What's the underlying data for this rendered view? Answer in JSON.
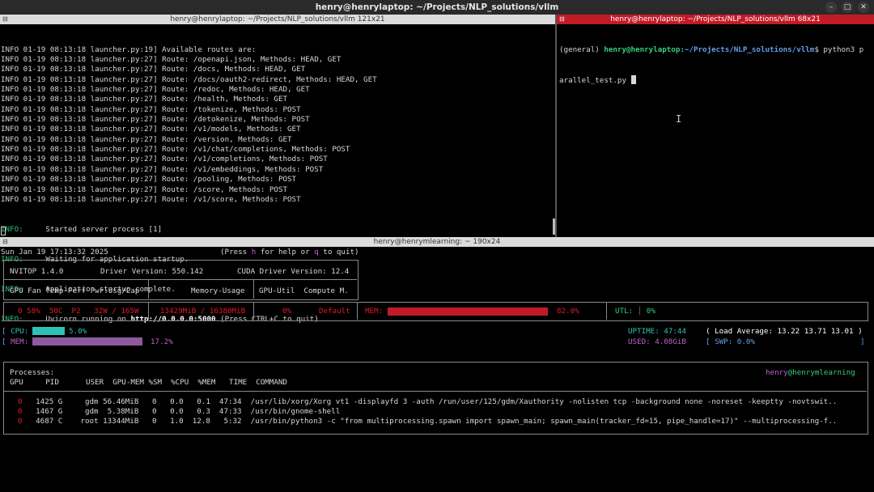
{
  "window": {
    "title": "henry@henrylaptop: ~/Projects/NLP_solutions/vllm",
    "minimize": "–",
    "maximize": "□",
    "close": "✕"
  },
  "pane_left": {
    "title": "henry@henrylaptop: ~/Projects/NLP_solutions/vllm 121x21",
    "lines": [
      "INFO 01-19 08:13:18 launcher.py:19] Available routes are:",
      "INFO 01-19 08:13:18 launcher.py:27] Route: /openapi.json, Methods: HEAD, GET",
      "INFO 01-19 08:13:18 launcher.py:27] Route: /docs, Methods: HEAD, GET",
      "INFO 01-19 08:13:18 launcher.py:27] Route: /docs/oauth2-redirect, Methods: HEAD, GET",
      "INFO 01-19 08:13:18 launcher.py:27] Route: /redoc, Methods: HEAD, GET",
      "INFO 01-19 08:13:18 launcher.py:27] Route: /health, Methods: GET",
      "INFO 01-19 08:13:18 launcher.py:27] Route: /tokenize, Methods: POST",
      "INFO 01-19 08:13:18 launcher.py:27] Route: /detokenize, Methods: POST",
      "INFO 01-19 08:13:18 launcher.py:27] Route: /v1/models, Methods: GET",
      "INFO 01-19 08:13:18 launcher.py:27] Route: /version, Methods: GET",
      "INFO 01-19 08:13:18 launcher.py:27] Route: /v1/chat/completions, Methods: POST",
      "INFO 01-19 08:13:18 launcher.py:27] Route: /v1/completions, Methods: POST",
      "INFO 01-19 08:13:18 launcher.py:27] Route: /v1/embeddings, Methods: POST",
      "INFO 01-19 08:13:18 launcher.py:27] Route: /pooling, Methods: POST",
      "INFO 01-19 08:13:18 launcher.py:27] Route: /score, Methods: POST",
      "INFO 01-19 08:13:18 launcher.py:27] Route: /v1/score, Methods: POST"
    ],
    "uvicorn": [
      {
        "level": "INFO:",
        "msg": "     Started server process [1]"
      },
      {
        "level": "INFO:",
        "msg": "     Waiting for application startup."
      },
      {
        "level": "INFO:",
        "msg": "     Application startup complete."
      }
    ],
    "running": {
      "level": "INFO:",
      "pre": "     Uvicorn running on ",
      "url": "http://0.0.0.0:5000",
      "post": " (Press CTRL+C to quit)"
    }
  },
  "pane_right": {
    "title": "henry@henrylaptop: ~/Projects/NLP_solutions/vllm 68x21",
    "env": "(general) ",
    "user_host": "henry@henrylaptop",
    "path": ":~/Projects/NLP_solutions/vllm",
    "cmd1": "$ python3 p",
    "cmd2": "arallel_test.py "
  },
  "pane_bottom": {
    "title": "henry@henrymlearning: ~ 190x24",
    "date": "Sun Jan 19 17:13:32 2025",
    "help": {
      "pre": "(Press ",
      "h": "h",
      "mid": " for help or ",
      "q": "q",
      "post": " to quit)"
    },
    "header": {
      "nvitop": "NVITOP 1.4.0",
      "driver": "Driver Version: 550.142",
      "cuda": "CUDA Driver Version: 12.4",
      "col1": "GPU Fan Temp Perf Pwr:Usg/Cap",
      "col2": "Memory-Usage",
      "col3": "GPU-Util  Compute M."
    },
    "gpu": {
      "id": "0",
      "fan": "58%",
      "temp": "50C",
      "perf": "P2",
      "pwr": "32W / 165W",
      "mem": "13429MiB / 16380MiB",
      "util": "0%",
      "compute": "Default",
      "mem_label": "MEM:",
      "mem_pct": "82.0%",
      "mem_frac": 0.82,
      "util_label": "UTL:",
      "util_pct": "0%"
    },
    "host": {
      "cpu_label": "CPU:",
      "cpu_pct": "5.0%",
      "cpu_frac": 0.05,
      "mem_label": "MEM:",
      "mem_pct": "17.2%",
      "mem_frac": 0.172,
      "uptime": "UPTIME: 47:44",
      "load": "( Load Average: 13.22 13.71 13.01 )",
      "used": "USED: 4.08GiB",
      "swp_label": "SWP:",
      "swp_pct": "0.0%"
    },
    "processes": {
      "label": "Processes:",
      "user": "henry",
      "at_host": "@henrymlearning",
      "columns": "GPU     PID      USER  GPU-MEM %SM  %CPU  %MEM   TIME  COMMAND",
      "rows": [
        {
          "gpu": "0",
          "rest": "   1425 G     gdm 56.46MiB   0   0.0   0.1  47:34  /usr/lib/xorg/Xorg vt1 -displayfd 3 -auth /run/user/125/gdm/Xauthority -nolisten tcp -background none -noreset -keeptty -novtswit.."
        },
        {
          "gpu": "0",
          "rest": "   1467 G     gdm  5.38MiB   0   0.0   0.3  47:33  /usr/bin/gnome-shell"
        },
        {
          "gpu": "0",
          "rest": "   4687 C    root 13344MiB   0   1.0  12.8   5:32  /usr/bin/python3 -c \"from multiprocessing.spawn import spawn_main; spawn_main(tracker_fd=15, pipe_handle=17)\" --multiprocessing-f.."
        }
      ]
    }
  },
  "colors": {
    "accent_red": "#e01b24",
    "green": "#33d17a",
    "cyan": "#2ec2b6",
    "magenta": "#c061cb"
  }
}
